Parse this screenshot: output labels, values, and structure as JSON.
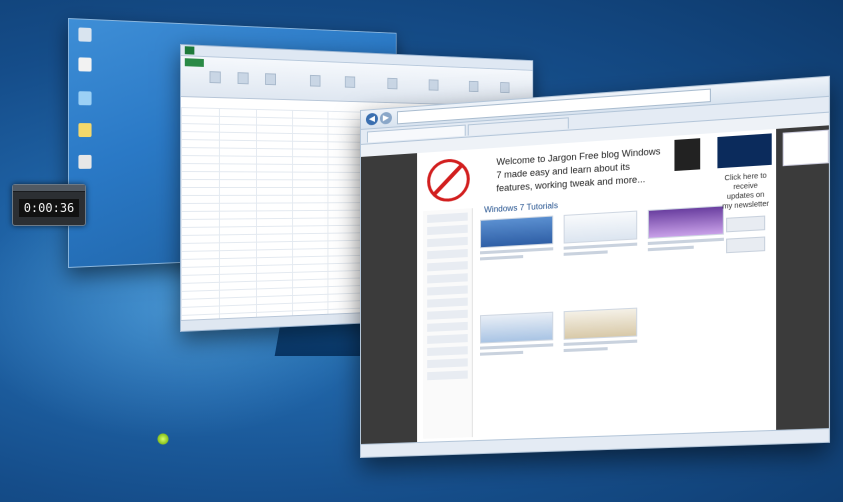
{
  "overlay": {
    "timer": "0:00:36"
  },
  "browser": {
    "site": {
      "welcome_text": "Welcome to Jargon Free blog Windows 7 made easy and learn about its features, working tweak and more...",
      "breadcrumb": "Windows 7 Tutorials",
      "right_sidebar_text": "Click here to receive updates on my newsletter"
    }
  },
  "colors": {
    "desktop_background": "#1f63a6",
    "excel_accent": "#1d7a3a",
    "logo_red": "#d21f1f"
  }
}
